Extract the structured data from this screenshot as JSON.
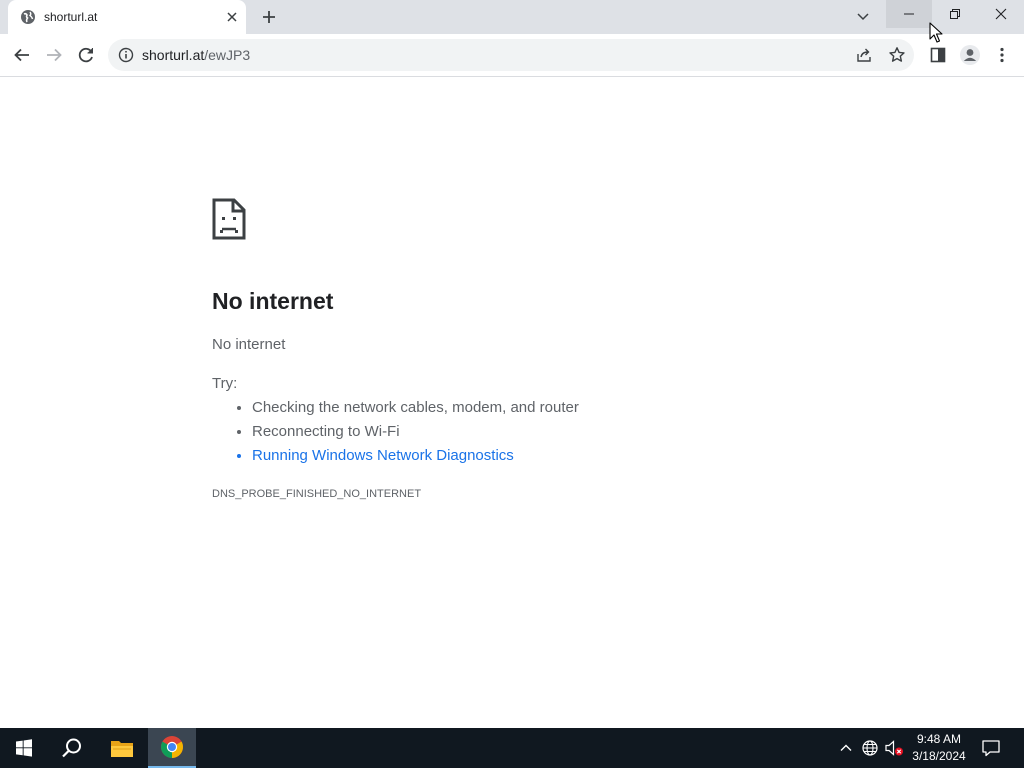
{
  "browser": {
    "tab": {
      "title": "shorturl.at",
      "favicon": "globe-icon"
    },
    "new_tab_icon": "plus-icon",
    "tab_search_icon": "chevron-down-icon",
    "window_controls": [
      "minimize-icon",
      "restore-icon",
      "close-icon"
    ],
    "toolbar": {
      "back_icon": "arrow-left-icon",
      "forward_icon": "arrow-right-icon",
      "reload_icon": "reload-icon",
      "address": {
        "host": "shorturl.at",
        "path": "/ewJP3",
        "site_info_icon": "info-icon"
      },
      "share_icon": "share-icon",
      "bookmark_icon": "star-icon",
      "side_panel_icon": "side-panel-icon",
      "profile_icon": "avatar-icon",
      "menu_icon": "kebab-menu-icon"
    }
  },
  "page": {
    "icon": "sad-page-icon",
    "heading": "No internet",
    "summary": "No internet",
    "try_label": "Try:",
    "suggestions": [
      "Checking the network cables, modem, and router",
      "Reconnecting to Wi-Fi",
      "Running Windows Network Diagnostics"
    ],
    "error_code": "DNS_PROBE_FINISHED_NO_INTERNET"
  },
  "taskbar": {
    "apps": [
      "windows-start-icon",
      "search-icon",
      "file-explorer-icon",
      "chrome-icon"
    ],
    "tray": [
      "chevron-up-icon",
      "network-globe-icon",
      "volume-muted-icon"
    ],
    "time": "9:48 AM",
    "date": "3/18/2024",
    "notifications_icon": "notification-icon"
  },
  "colors": {
    "tab_strip": "#dee1e6",
    "omnibox": "#f1f3f4",
    "link": "#1a73e8",
    "text_secondary": "#5f6368",
    "taskbar": "#101820"
  }
}
